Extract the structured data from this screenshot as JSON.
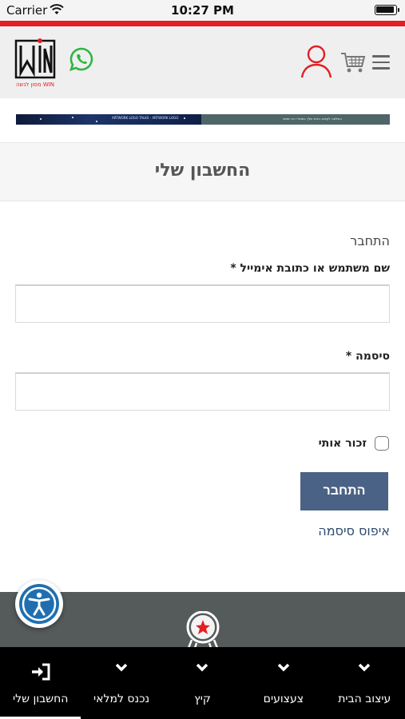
{
  "status_bar": {
    "carrier": "Carrier",
    "time": "10:27 PM"
  },
  "header": {
    "logo_text": "WIN",
    "logo_tagline": "מסון לנשה WIN",
    "icons": [
      "whatsapp-icon",
      "user-icon",
      "cart-icon",
      "menu-icon"
    ],
    "accent_color": "#e31e24"
  },
  "banner": {
    "left_text": "ARTWORK LOGO TALKS - ARTWORK LOGO",
    "right_text": "השלמה לעיצוב הבית שלך במוצרי הכי שווים"
  },
  "page": {
    "title": "החשבון שלי"
  },
  "form": {
    "heading": "התחבר",
    "username_label": "שם משתמש או כתובת אימייל *",
    "username_value": "",
    "password_label": "סיסמה *",
    "password_value": "",
    "remember_label": "זכור אותי",
    "remember_checked": false,
    "login_button": "התחבר",
    "forgot_link": "איפוס סיסמה",
    "button_color": "#4a6285"
  },
  "bottom_nav": {
    "items": [
      {
        "label": "החשבון שלי",
        "icon": "login-icon",
        "active": true
      },
      {
        "label": "נכנס למלאי",
        "icon": "chevron-down-icon",
        "active": false
      },
      {
        "label": "קיץ",
        "icon": "chevron-down-icon",
        "active": false
      },
      {
        "label": "צעצועים",
        "icon": "chevron-down-icon",
        "active": false
      },
      {
        "label": "עיצוב הבית",
        "icon": "chevron-down-icon",
        "active": false
      }
    ]
  }
}
